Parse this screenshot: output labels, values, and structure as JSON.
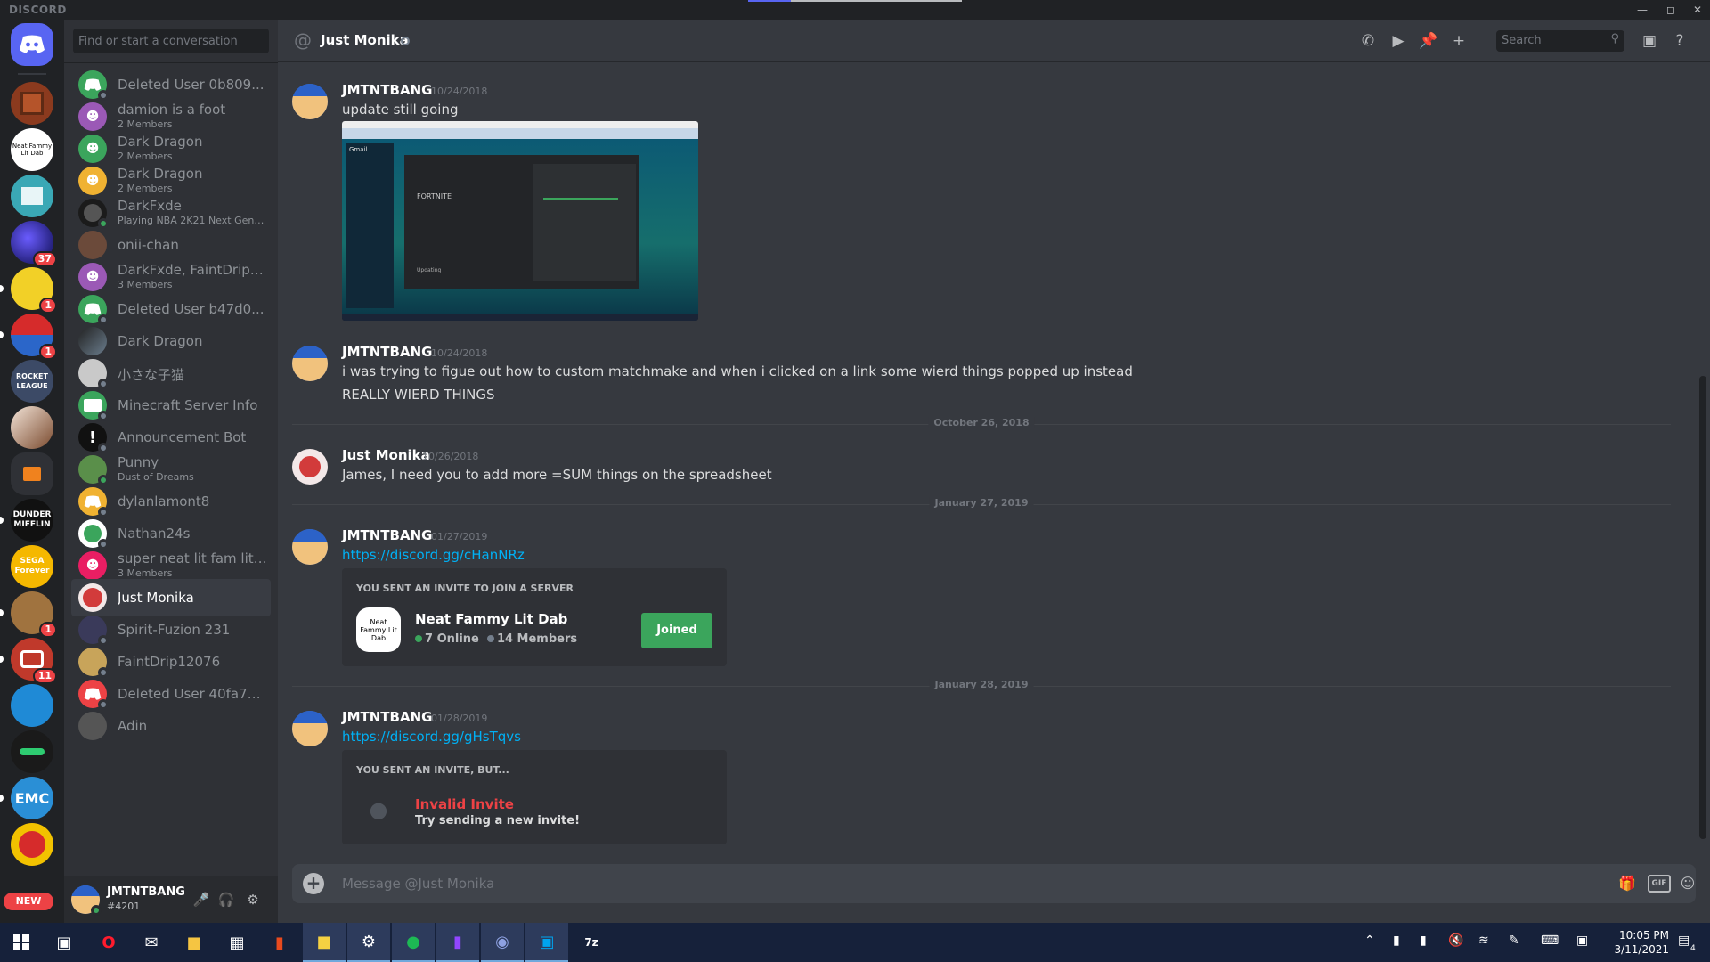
{
  "app": {
    "brand": "DISCORD"
  },
  "servers": [
    {
      "name": "Home",
      "badge": ""
    },
    {
      "name": "Minecraft Chest",
      "badge": ""
    },
    {
      "name": "Neat Fammy Lit Dab",
      "badge": ""
    },
    {
      "name": "Museum",
      "badge": ""
    },
    {
      "name": "Galaxy",
      "badge": "37"
    },
    {
      "name": "SpongeBob",
      "badge": "1"
    },
    {
      "name": "Pokeball",
      "badge": "1"
    },
    {
      "name": "Rocket League",
      "badge": ""
    },
    {
      "name": "Brown",
      "badge": ""
    },
    {
      "name": "Folder",
      "badge": ""
    },
    {
      "name": "Dunder Mifflin",
      "badge": ""
    },
    {
      "name": "SEGA Forever",
      "badge": ""
    },
    {
      "name": "Parks and Recreation",
      "badge": "1"
    },
    {
      "name": "Red TV",
      "badge": "11"
    },
    {
      "name": "Supreme Dunes",
      "badge": ""
    },
    {
      "name": "Sharkbyte",
      "badge": ""
    },
    {
      "name": "EMC",
      "badge": ""
    },
    {
      "name": "Logo Red",
      "badge": ""
    }
  ],
  "server_rail": {
    "new_label": "NEW",
    "dunder_text": "DUNDER MIFFLIN",
    "sega_text": "SEGA Forever",
    "emc_text": "EMC",
    "rocket_text": "ROCKET LEAGUE",
    "neat_text": "Neat Fammy Lit Dab"
  },
  "dm_sidebar": {
    "search_placeholder": "Find or start a conversation",
    "items": [
      {
        "name": "Deleted User 0b809...",
        "sub": ""
      },
      {
        "name": "damion is a foot",
        "sub": "2 Members"
      },
      {
        "name": "Dark Dragon",
        "sub": "2 Members"
      },
      {
        "name": "Dark Dragon",
        "sub": "2 Members"
      },
      {
        "name": "DarkFxde",
        "sub": "Playing NBA 2K21 Next Gene..."
      },
      {
        "name": "onii-chan",
        "sub": ""
      },
      {
        "name": "DarkFxde, FaintDrip1...",
        "sub": "3 Members"
      },
      {
        "name": "Deleted User b47d0...",
        "sub": ""
      },
      {
        "name": "Dark Dragon",
        "sub": ""
      },
      {
        "name": "小さな子猫",
        "sub": ""
      },
      {
        "name": "Minecraft Server Info",
        "sub": ""
      },
      {
        "name": "Announcement Bot",
        "sub": ""
      },
      {
        "name": "Punny",
        "sub": "Dust of Dreams"
      },
      {
        "name": "dylanlamont8",
        "sub": ""
      },
      {
        "name": "Nathan24s",
        "sub": ""
      },
      {
        "name": "super neat lit fam lit ...",
        "sub": "3 Members"
      },
      {
        "name": "Just Monika",
        "sub": ""
      },
      {
        "name": "Spirit-Fuzion 231",
        "sub": ""
      },
      {
        "name": "FaintDrip12076",
        "sub": ""
      },
      {
        "name": "Deleted User 40fa77...",
        "sub": ""
      },
      {
        "name": "Adin",
        "sub": ""
      }
    ],
    "user": {
      "name": "JMTNTBANG",
      "tag": "#4201"
    }
  },
  "header": {
    "title": "Just Monika",
    "search_placeholder": "Search"
  },
  "messages": [
    {
      "author": "JMTNTBANG",
      "timestamp": "10/24/2018",
      "lines": [
        "update still going"
      ]
    },
    {
      "author": "JMTNTBANG",
      "timestamp": "10/24/2018",
      "lines": [
        "i was trying to figue out how to custom matchmake and when i clicked on a link some wierd things popped up instead",
        "REALLY WIERD THINGS"
      ]
    },
    {
      "author": "Just Monika",
      "timestamp": "10/26/2018",
      "lines": [
        "James, I need you to add more =SUM things on the spreadsheet"
      ]
    },
    {
      "author": "JMTNTBANG",
      "timestamp": "01/27/2019",
      "lines": [
        "https://discord.gg/cHanNRz"
      ]
    },
    {
      "author": "JMTNTBANG",
      "timestamp": "01/28/2019",
      "lines": [
        "https://discord.gg/gHsTqvs"
      ]
    }
  ],
  "dividers": [
    "October 26, 2018",
    "January 27, 2019",
    "January 28, 2019"
  ],
  "screenshot": {
    "title": "FORTNITE",
    "status": "Updating",
    "gmail": "Gmail"
  },
  "invite_ok": {
    "heading": "YOU SENT AN INVITE TO JOIN A SERVER",
    "server": "Neat Fammy Lit Dab",
    "online": "7 Online",
    "members": "14 Members",
    "button": "Joined",
    "icon_text": "Neat Fammy Lit Dab"
  },
  "invite_bad": {
    "heading": "YOU SENT AN INVITE, BUT...",
    "title": "Invalid Invite",
    "subtitle": "Try sending a new invite!"
  },
  "composer": {
    "placeholder": "Message @Just Monika",
    "gif": "GIF"
  },
  "taskbar": {
    "time": "10:05 PM",
    "date": "3/11/2021",
    "notifications": "4"
  },
  "colors": {
    "accent": "#5865f2",
    "online": "#3ba55c",
    "danger": "#ed4245",
    "link": "#00b0f4"
  }
}
